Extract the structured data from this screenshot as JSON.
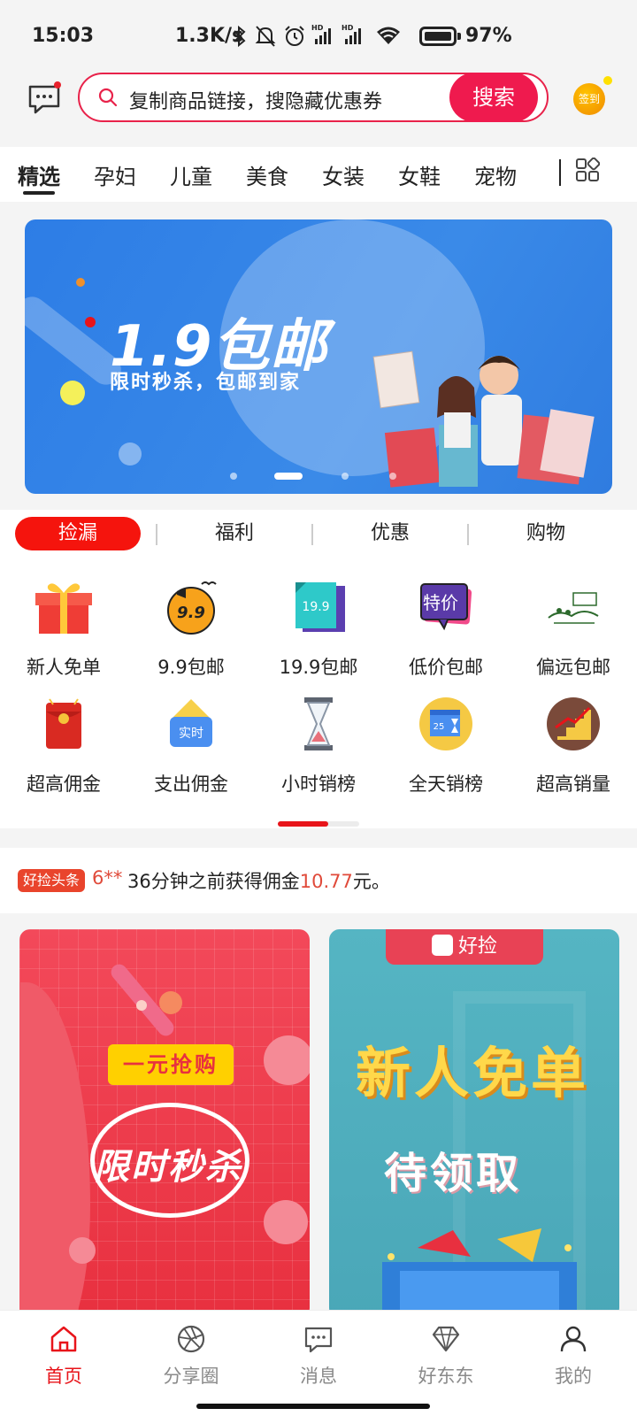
{
  "status_bar": {
    "time": "15:03",
    "network_speed": "1.3K/s",
    "battery_pct": "97%",
    "icons": [
      "bluetooth-icon",
      "mute-bell-icon",
      "alarm-icon",
      "signal-hd-icon",
      "signal-hd-icon",
      "wifi-icon",
      "battery-icon"
    ]
  },
  "header": {
    "search_placeholder": "复制商品链接，搜隐藏优惠券",
    "search_button": "搜索",
    "signin_label": "签到"
  },
  "categories": [
    {
      "label": "精选",
      "active": true
    },
    {
      "label": "孕妇",
      "active": false
    },
    {
      "label": "儿童",
      "active": false
    },
    {
      "label": "美食",
      "active": false
    },
    {
      "label": "女装",
      "active": false
    },
    {
      "label": "女鞋",
      "active": false
    },
    {
      "label": "宠物",
      "active": false
    }
  ],
  "banner": {
    "title": "1.9包邮",
    "subtitle": "限时秒杀，包邮到家",
    "active_slide": 2
  },
  "section_tabs": [
    {
      "label": "捡漏",
      "active": true
    },
    {
      "label": "福利",
      "active": false
    },
    {
      "label": "优惠",
      "active": false
    },
    {
      "label": "购物",
      "active": false
    }
  ],
  "icon_grid": [
    {
      "label": "新人免单",
      "icon": "gift-box-icon"
    },
    {
      "label": "9.9包邮",
      "icon": "megaphone-99-icon",
      "badge": "9.9"
    },
    {
      "label": "19.9包邮",
      "icon": "tag-199-icon",
      "badge": "19.9"
    },
    {
      "label": "低价包邮",
      "icon": "special-price-icon",
      "badge": "特价"
    },
    {
      "label": "偏远包邮",
      "icon": "remote-landscape-icon"
    },
    {
      "label": "超高佣金",
      "icon": "red-envelope-icon"
    },
    {
      "label": "支出佣金",
      "icon": "realtime-icon",
      "badge": "实时"
    },
    {
      "label": "小时销榜",
      "icon": "hourglass-icon"
    },
    {
      "label": "全天销榜",
      "icon": "calendar-icon",
      "badge": "25"
    },
    {
      "label": "超高销量",
      "icon": "sales-chart-icon"
    }
  ],
  "icon_grid_progress": 0.62,
  "ticker": {
    "badge": "好捡头条",
    "user": "6**",
    "text_before": " 36分钟之前获得佣金",
    "amount": "10.77",
    "text_after": "元。"
  },
  "promo_left": {
    "tag": "一元抢购",
    "title": "限时秒杀"
  },
  "promo_right": {
    "brand": "好捡",
    "title": "新人免单",
    "subtitle": "待领取"
  },
  "bottom_nav": [
    {
      "label": "首页",
      "icon": "home-icon",
      "active": true
    },
    {
      "label": "分享圈",
      "icon": "aperture-icon",
      "active": false
    },
    {
      "label": "消息",
      "icon": "message-icon",
      "active": false
    },
    {
      "label": "好东东",
      "icon": "diamond-icon",
      "active": false
    },
    {
      "label": "我的",
      "icon": "user-icon",
      "active": false
    }
  ],
  "colors": {
    "accent": "#e8141a",
    "search_button": "#ef1a4e",
    "banner_blue": "#2d7de6"
  }
}
